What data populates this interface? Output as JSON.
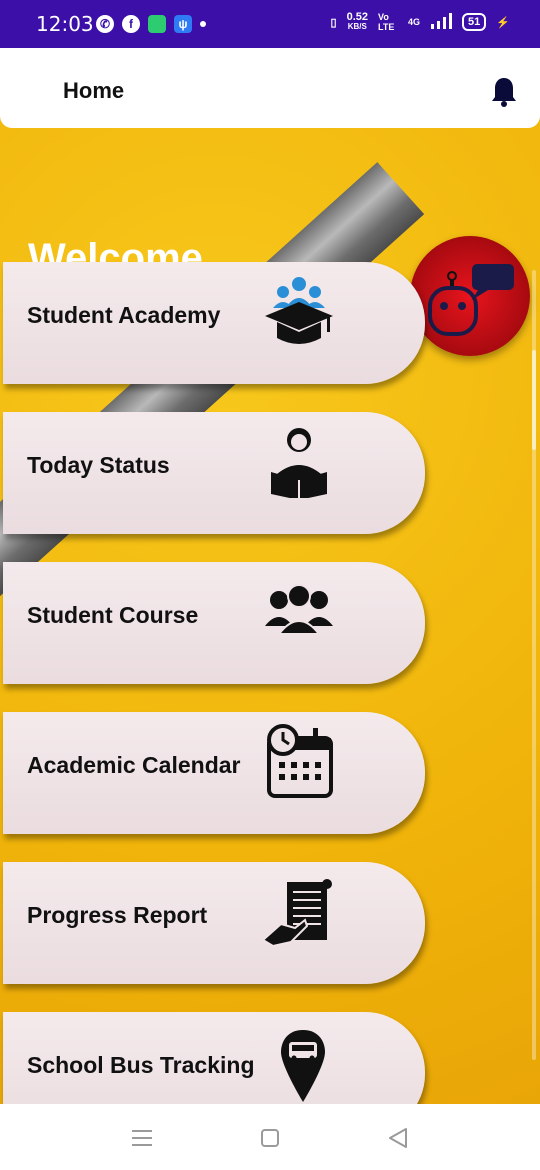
{
  "status_bar": {
    "time": "12:03",
    "net_speed_value": "0.52",
    "net_speed_unit": "KB/S",
    "network": "Vo LTE",
    "signal_type": "4G",
    "battery": "51",
    "icons": [
      "phone-call-icon",
      "facebook-icon",
      "chat-app-icon",
      "usb-icon",
      "vibrate-icon",
      "signal-icon",
      "battery-icon"
    ]
  },
  "header": {
    "title": "Home",
    "icon": "bell-icon"
  },
  "welcome_text": "Welcome",
  "menu": {
    "items": [
      {
        "label": "Student Academy",
        "icon": "graduation-group-icon"
      },
      {
        "label": "Today Status",
        "icon": "student-reading-icon"
      },
      {
        "label": "Student Course",
        "icon": "user-group-icon"
      },
      {
        "label": "Academic Calendar",
        "icon": "calendar-clock-icon"
      },
      {
        "label": "Progress Report",
        "icon": "report-scroll-icon"
      },
      {
        "label": "School Bus Tracking",
        "icon": "bus-location-pin-icon"
      }
    ]
  },
  "chat_bot": {
    "icon": "robot-chat-icon"
  },
  "colors": {
    "status_bar": "#3c0fa8",
    "background": "#f0b40a",
    "pill": "#efe3e5",
    "bot": "#d6121b",
    "icon_blue": "#2a8fd6"
  },
  "nav": [
    "menu-icon",
    "home-icon",
    "back-icon"
  ]
}
